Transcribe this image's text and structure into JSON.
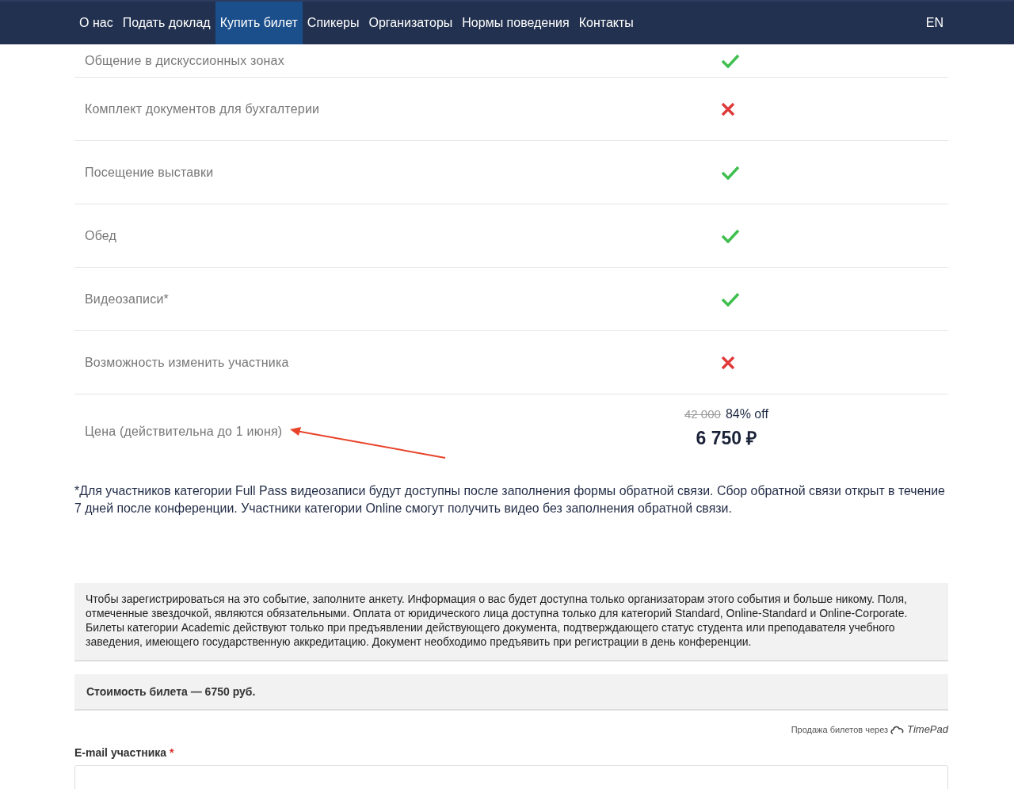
{
  "nav": {
    "items": [
      {
        "label": "О нас",
        "selected": false
      },
      {
        "label": "Подать доклад",
        "selected": false
      },
      {
        "label": "Купить билет",
        "selected": true
      },
      {
        "label": "Спикеры",
        "selected": false
      },
      {
        "label": "Организаторы",
        "selected": false
      },
      {
        "label": "Нормы поведения",
        "selected": false
      },
      {
        "label": "Контакты",
        "selected": false
      }
    ],
    "language": "EN"
  },
  "features": [
    {
      "label": "Общение в дискуссионных зонах",
      "included": true
    },
    {
      "label": "Комплект документов для бухгалтерии",
      "included": false
    },
    {
      "label": "Посещение выставки",
      "included": true
    },
    {
      "label": "Обед",
      "included": true
    },
    {
      "label": "Видеозаписи*",
      "included": true
    },
    {
      "label": "Возможность изменить участника",
      "included": false
    }
  ],
  "price": {
    "label": "Цена (действительна до 1 июня)",
    "old_price": "42 000",
    "discount": "84% off",
    "price": "6 750 ₽"
  },
  "footnote": "*Для участников категории Full Pass видеозаписи будут доступны после заполнения формы обратной связи. Сбор обратной связи открыт в течение 7 дней после конференции. Участники категории Online смогут получить видео без заполнения обратной связи.",
  "form": {
    "info": "Чтобы зарегистрироваться на это событие, заполните анкету. Информация о вас будет доступна только организаторам этого события и больше никому. Поля, отмеченные звездочкой, являются обязательными. Оплата от юридического лица доступна только для категорий Standard, Online-Standard и Online-Corporate. Билеты категории Academic действуют только при предъявлении действующего документа, подтверждающего статус студента или преподавателя учебного заведения, имеющего государственную аккредитацию. Документ необходимо предъявить при регистрации в день конференции.",
    "cost": "Стоимость билета — 6750 руб.",
    "sold_via": "Продажа билетов через",
    "provider": "TimePad",
    "email_label": "E-mail участника",
    "required_mark": "*"
  }
}
